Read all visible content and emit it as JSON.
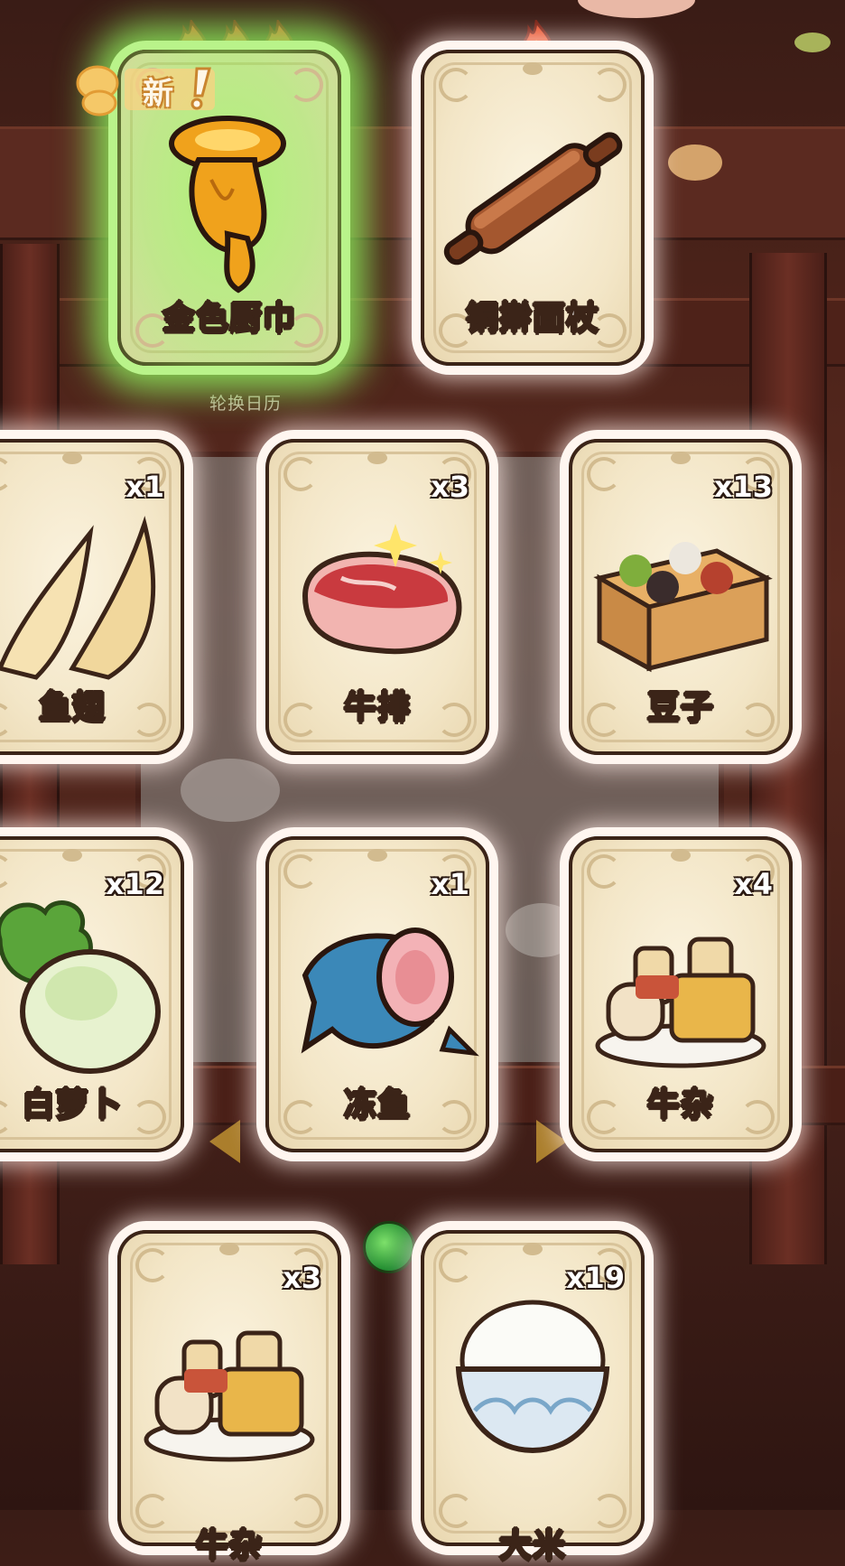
{
  "background": {
    "calendar_label": "轮换日历"
  },
  "new_badge": {
    "text": "新",
    "icon": "exclamation-icon"
  },
  "tools": [
    {
      "name": "金色厨巾",
      "flames": 3,
      "highlight": true,
      "icon": "golden-towel-icon"
    },
    {
      "name": "铜擀面杖",
      "flames": 1,
      "highlight": false,
      "icon": "rolling-pin-icon"
    }
  ],
  "ingredients": [
    {
      "name": "鱼翅",
      "count": "x1",
      "icon": "shark-fin-icon"
    },
    {
      "name": "牛排",
      "count": "x3",
      "icon": "steak-icon"
    },
    {
      "name": "豆子",
      "count": "x13",
      "icon": "beans-box-icon"
    },
    {
      "name": "白萝卜",
      "count": "x12",
      "icon": "radish-icon"
    },
    {
      "name": "冻鱼",
      "count": "x1",
      "icon": "frozen-fish-icon"
    },
    {
      "name": "牛杂",
      "count": "x4",
      "icon": "beef-offal-icon"
    },
    {
      "name": "牛杂",
      "count": "x3",
      "icon": "beef-offal-icon"
    },
    {
      "name": "大米",
      "count": "x19",
      "icon": "rice-bowl-icon"
    }
  ],
  "colors": {
    "card_border": "#3b2418",
    "card_face": "#f3e6c7",
    "highlight_glow": "#8ce65a",
    "flame": "#e8502a"
  }
}
